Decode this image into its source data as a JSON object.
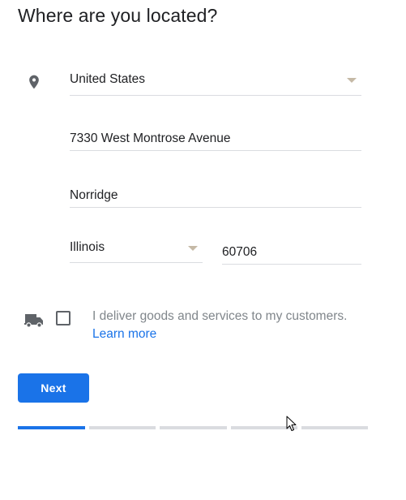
{
  "page": {
    "title": "Where are you located?"
  },
  "address": {
    "country": "United States",
    "street": "7330 West Montrose Avenue",
    "city": "Norridge",
    "state": "Illinois",
    "zip": "60706"
  },
  "delivery": {
    "text": "I deliver goods and services to my customers.",
    "learn_more": "Learn more",
    "checked": false
  },
  "actions": {
    "next_label": "Next"
  },
  "progress": {
    "total_steps": 5,
    "current_step": 1
  },
  "icons": {
    "location": "location-pin-icon",
    "delivery": "delivery-truck-icon",
    "dropdown": "dropdown-caret-icon"
  },
  "colors": {
    "accent": "#1a73e8",
    "text": "#202124",
    "muted_text": "#80868b",
    "divider": "#dadce0",
    "icon": "#5f6368"
  }
}
